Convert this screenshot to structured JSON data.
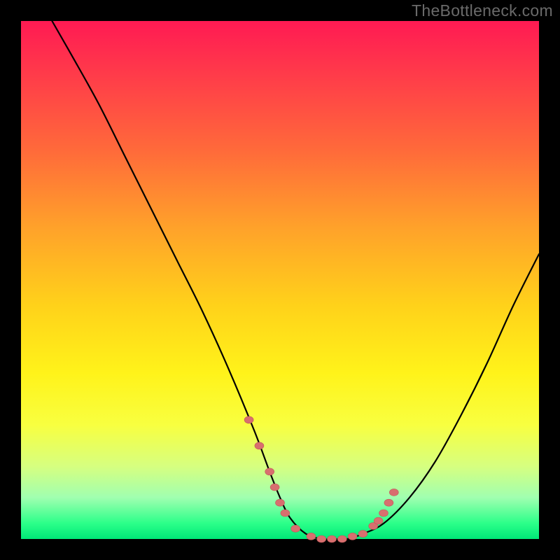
{
  "watermark": "TheBottleneck.com",
  "colors": {
    "background": "#000000",
    "gradient_top": "#ff1a53",
    "gradient_bottom": "#00e878",
    "curve": "#000000",
    "marker": "#d86f6f"
  },
  "chart_data": {
    "type": "line",
    "title": "",
    "xlabel": "",
    "ylabel": "",
    "xlim": [
      0,
      100
    ],
    "ylim": [
      0,
      100
    ],
    "series": [
      {
        "name": "bottleneck-curve",
        "x": [
          6,
          10,
          15,
          20,
          25,
          30,
          35,
          40,
          45,
          48,
          50,
          52,
          55,
          58,
          60,
          63,
          66,
          70,
          75,
          80,
          85,
          90,
          95,
          100
        ],
        "y": [
          100,
          93,
          84,
          74,
          64,
          54,
          44,
          33,
          21,
          13,
          8,
          4,
          1,
          0,
          0,
          0,
          1,
          3,
          8,
          15,
          24,
          34,
          45,
          55
        ]
      }
    ],
    "markers": {
      "name": "highlight-points",
      "x": [
        44,
        46,
        48,
        49,
        50,
        51,
        53,
        56,
        58,
        60,
        62,
        64,
        66,
        68,
        69,
        70,
        71,
        72
      ],
      "y": [
        23,
        18,
        13,
        10,
        7,
        5,
        2,
        0.5,
        0,
        0,
        0,
        0.5,
        1,
        2.5,
        3.5,
        5,
        7,
        9
      ]
    }
  }
}
